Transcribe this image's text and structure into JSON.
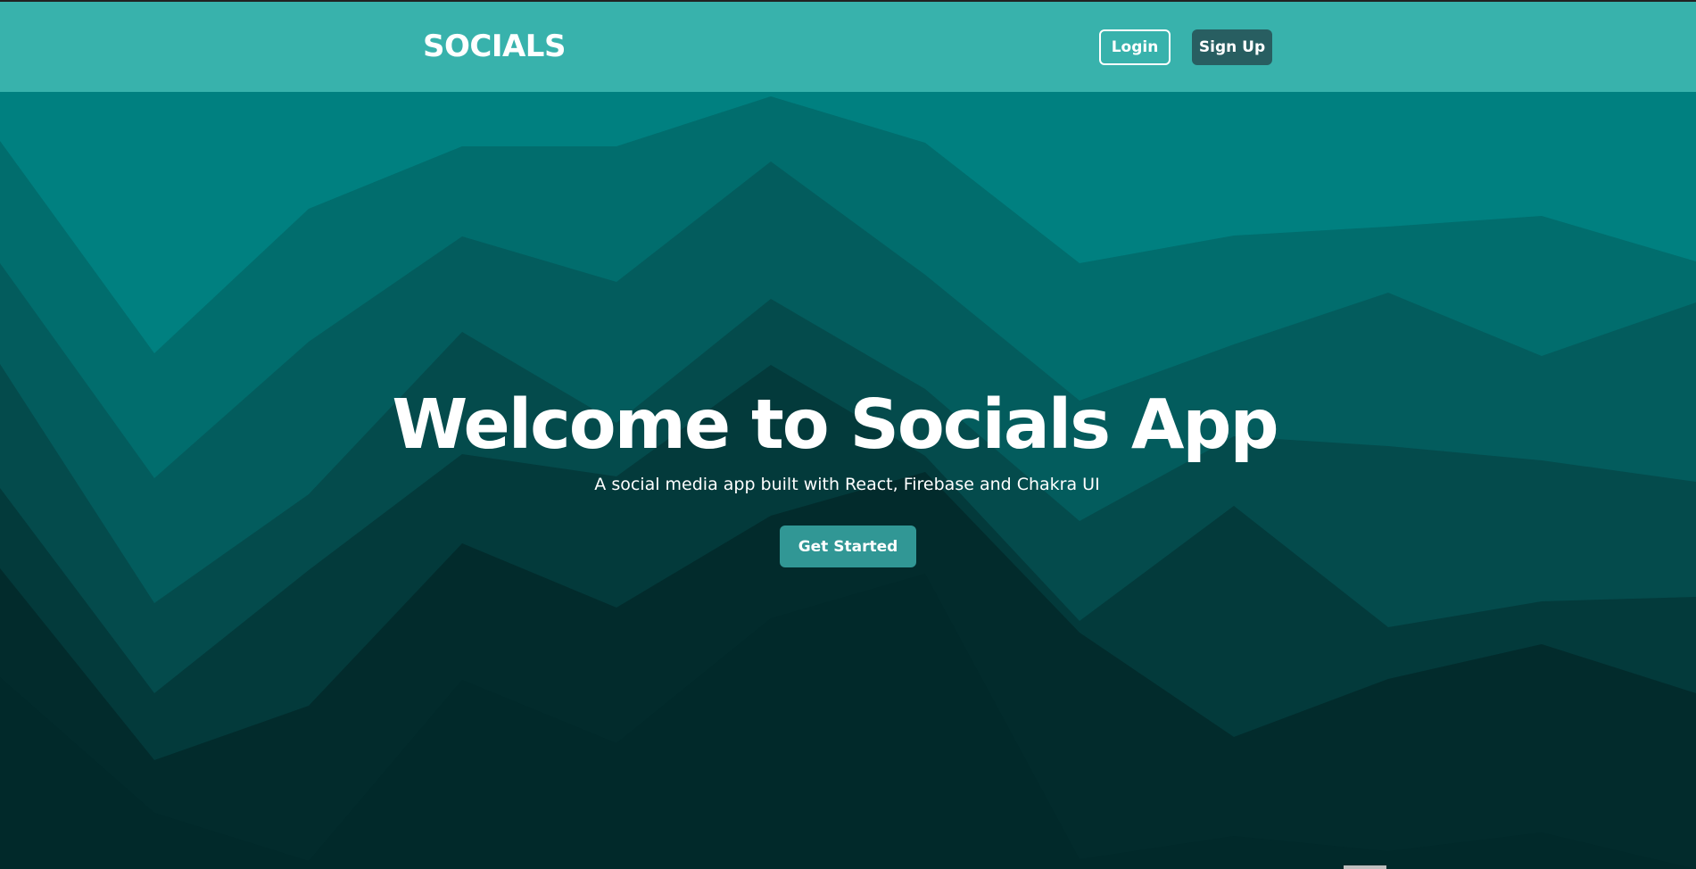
{
  "navbar": {
    "brand": "SOCIALS",
    "login_label": "Login",
    "signup_label": "Sign Up"
  },
  "hero": {
    "title": "Welcome to Socials App",
    "subtitle": "A social media app built with React, Firebase and Chakra UI",
    "cta_label": "Get Started"
  },
  "colors": {
    "navbar_bg": "#38b2ac",
    "signup_bg": "#285e61",
    "cta_bg": "#319795",
    "wave_layers": [
      "#008080",
      "#016d6d",
      "#035c5d",
      "#044b4c",
      "#033a3b",
      "#022b2c",
      "#01292a"
    ]
  }
}
